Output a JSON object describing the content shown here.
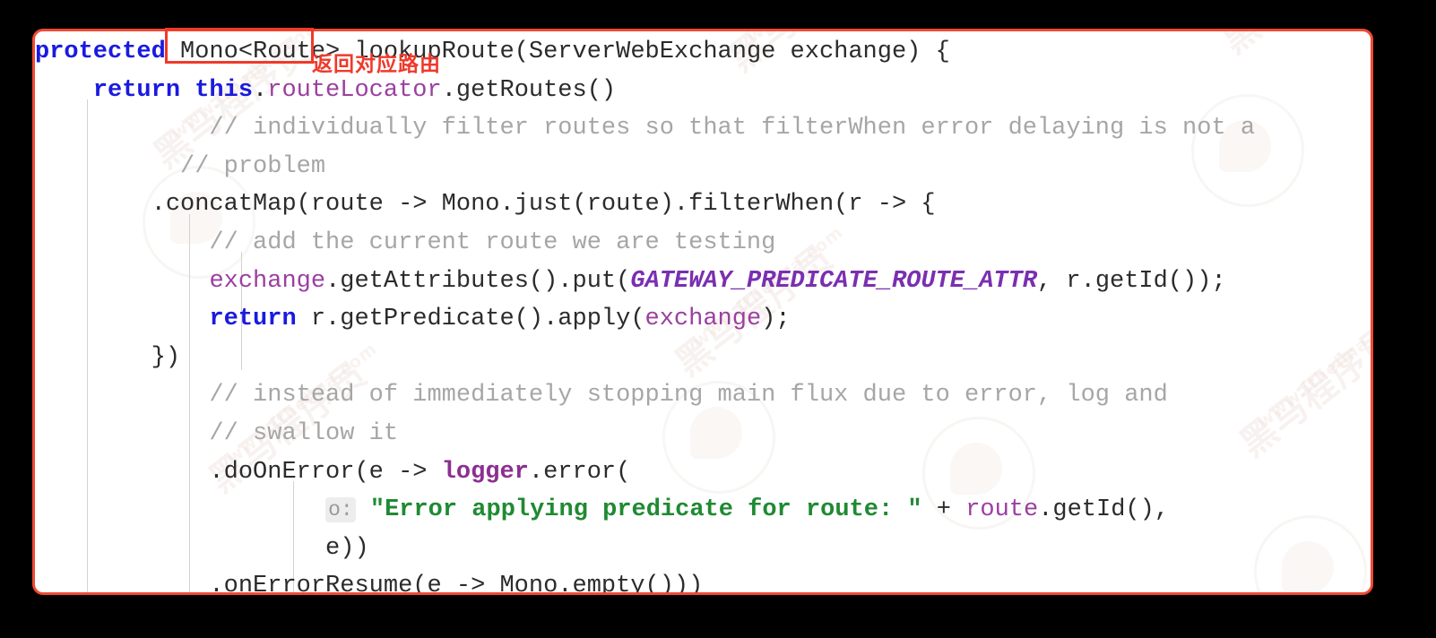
{
  "window": {
    "background_color": "#000000",
    "panel_background": "#ffffff",
    "border_color": "#f04a32"
  },
  "annotation": {
    "highlight_token": "Mono<Route>",
    "label_text": "返回对应路由",
    "color": "#f0392a"
  },
  "editor": {
    "language": "Java",
    "font": "monospace",
    "indent_guide_color": "#d2d2d4",
    "theme_colors": {
      "keyword": "#1a1ae0",
      "field": "#9b3fa0",
      "constant": "#7a2fb0",
      "comment": "#a6a6a6",
      "string": "#1f8a33",
      "plain": "#2b2b2b"
    },
    "parameter_hint": "o:",
    "lines": [
      {
        "indent": 0,
        "tokens": [
          {
            "t": "protected",
            "c": "kw"
          },
          {
            "t": " ",
            "c": "plain"
          },
          {
            "t": "Mono<Route>",
            "c": "plain"
          },
          {
            "t": " lookupRoute(ServerWebExchange exchange) {",
            "c": "plain"
          }
        ]
      },
      {
        "indent": 0,
        "tokens": [
          {
            "t": "    ",
            "c": "plain"
          },
          {
            "t": "return",
            "c": "kw"
          },
          {
            "t": " ",
            "c": "plain"
          },
          {
            "t": "this",
            "c": "kw"
          },
          {
            "t": ".",
            "c": "plain"
          },
          {
            "t": "routeLocator",
            "c": "field"
          },
          {
            "t": ".getRoutes()",
            "c": "plain"
          }
        ]
      },
      {
        "indent": 0,
        "tokens": [
          {
            "t": "            // individually filter routes so that filterWhen error delaying is not a",
            "c": "cmt"
          }
        ]
      },
      {
        "indent": 0,
        "tokens": [
          {
            "t": "          // problem",
            "c": "cmt"
          }
        ]
      },
      {
        "indent": 0,
        "tokens": [
          {
            "t": "        .concatMap(route -> Mono.just(route).filterWhen(r -> {",
            "c": "plain"
          }
        ]
      },
      {
        "indent": 0,
        "tokens": [
          {
            "t": "            // add the current route we are testing",
            "c": "cmt"
          }
        ]
      },
      {
        "indent": 0,
        "tokens": [
          {
            "t": "            ",
            "c": "plain"
          },
          {
            "t": "exchange",
            "c": "field"
          },
          {
            "t": ".getAttributes().put(",
            "c": "plain"
          },
          {
            "t": "GATEWAY_PREDICATE_ROUTE_ATTR",
            "c": "const"
          },
          {
            "t": ", r.getId());",
            "c": "plain"
          }
        ]
      },
      {
        "indent": 0,
        "tokens": [
          {
            "t": "            ",
            "c": "plain"
          },
          {
            "t": "return",
            "c": "kw"
          },
          {
            "t": " r.getPredicate().apply(",
            "c": "plain"
          },
          {
            "t": "exchange",
            "c": "field"
          },
          {
            "t": ");",
            "c": "plain"
          }
        ]
      },
      {
        "indent": 0,
        "tokens": [
          {
            "t": "        })",
            "c": "plain"
          }
        ]
      },
      {
        "indent": 0,
        "tokens": [
          {
            "t": "            // instead of immediately stopping main flux due to error, log and",
            "c": "cmt"
          }
        ]
      },
      {
        "indent": 0,
        "tokens": [
          {
            "t": "            // swallow it",
            "c": "cmt"
          }
        ]
      },
      {
        "indent": 0,
        "tokens": [
          {
            "t": "            .doOnError(e -> ",
            "c": "plain"
          },
          {
            "t": "logger",
            "c": "fieldb"
          },
          {
            "t": ".error(",
            "c": "plain"
          }
        ]
      },
      {
        "indent": 0,
        "hint": "o:",
        "hint_indent": 20,
        "tokens": [
          {
            "t": "                    ",
            "c": "plain"
          },
          {
            "t": "\"Error applying predicate for route: \"",
            "c": "str"
          },
          {
            "t": " + ",
            "c": "plain"
          },
          {
            "t": "route",
            "c": "field"
          },
          {
            "t": ".getId(),",
            "c": "plain"
          }
        ]
      },
      {
        "indent": 0,
        "tokens": [
          {
            "t": "                    e))",
            "c": "plain"
          }
        ]
      },
      {
        "indent": 0,
        "tokens": [
          {
            "t": "            .onErrorResume(e -> Mono.empty()))",
            "c": "plain"
          }
        ]
      }
    ]
  },
  "watermarks": {
    "brand_cn": "黑马程序员",
    "url": "www.itheima.com"
  }
}
